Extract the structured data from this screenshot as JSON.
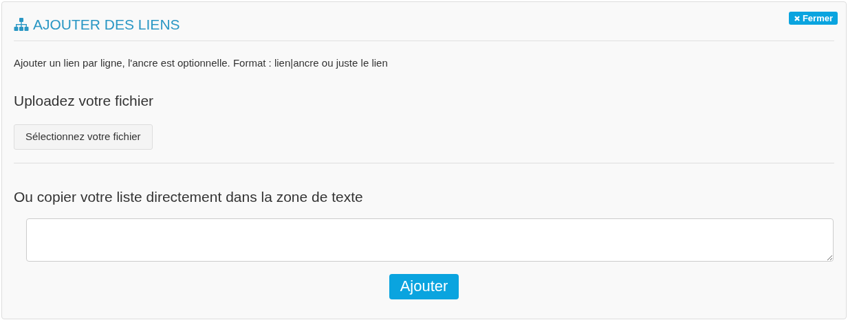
{
  "panel": {
    "title": "AJOUTER DES LIENS",
    "close_button": "Fermer"
  },
  "intro": "Ajouter un lien par ligne, l'ancre est optionnelle. Format : lien|ancre ou juste le lien",
  "upload": {
    "heading": "Uploadez votre fichier",
    "button": "Sélectionnez votre fichier"
  },
  "paste": {
    "heading": "Ou copier votre liste directement dans la zone de texte"
  },
  "submit_button": "Ajouter"
}
